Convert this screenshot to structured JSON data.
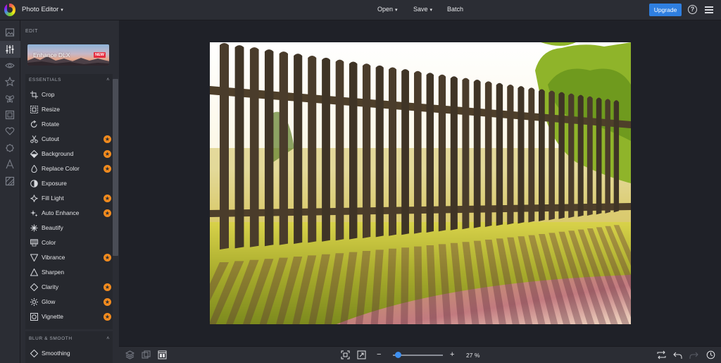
{
  "app": {
    "title": "Photo Editor"
  },
  "topbar": {
    "menus": [
      {
        "label": "Open",
        "has_dropdown": true
      },
      {
        "label": "Save",
        "has_dropdown": true
      },
      {
        "label": "Batch",
        "has_dropdown": false
      }
    ],
    "upgrade_label": "Upgrade",
    "help_glyph": "?",
    "accent_color": "#2f7fe0"
  },
  "rail": {
    "icons": [
      "image-icon",
      "sliders-icon",
      "eye-icon",
      "star-icon",
      "butterfly-icon",
      "frame-icon",
      "heart-icon",
      "badge-icon",
      "text-icon",
      "texture-icon"
    ],
    "active_index": 1
  },
  "panel": {
    "edit_label": "EDIT",
    "enhance_card": {
      "title": "Enhance DLX",
      "badge": "NEW"
    },
    "sections": [
      {
        "title": "ESSENTIALS",
        "expanded": true,
        "tools": [
          {
            "label": "Crop",
            "icon": "crop-icon",
            "premium": false
          },
          {
            "label": "Resize",
            "icon": "resize-icon",
            "premium": false
          },
          {
            "label": "Rotate",
            "icon": "rotate-icon",
            "premium": false
          },
          {
            "label": "Cutout",
            "icon": "scissors-icon",
            "premium": true
          },
          {
            "label": "Background",
            "icon": "background-icon",
            "premium": true
          },
          {
            "label": "Replace Color",
            "icon": "drop-icon",
            "premium": true
          },
          {
            "label": "Exposure",
            "icon": "exposure-icon",
            "premium": false
          },
          {
            "label": "Fill Light",
            "icon": "fill-light-icon",
            "premium": true
          },
          {
            "label": "Auto Enhance",
            "icon": "sparkle-icon",
            "premium": true
          },
          {
            "label": "Beautify",
            "icon": "beautify-icon",
            "premium": false
          },
          {
            "label": "Color",
            "icon": "color-icon",
            "premium": false
          },
          {
            "label": "Vibrance",
            "icon": "vibrance-icon",
            "premium": true
          },
          {
            "label": "Sharpen",
            "icon": "sharpen-icon",
            "premium": false
          },
          {
            "label": "Clarity",
            "icon": "clarity-icon",
            "premium": true
          },
          {
            "label": "Glow",
            "icon": "glow-icon",
            "premium": true
          },
          {
            "label": "Vignette",
            "icon": "vignette-icon",
            "premium": true
          }
        ]
      },
      {
        "title": "BLUR & SMOOTH",
        "expanded": true,
        "tools": [
          {
            "label": "Smoothing",
            "icon": "smoothing-icon",
            "premium": false
          }
        ]
      }
    ],
    "premium_color": "#f28b1e"
  },
  "bottombar": {
    "zoom_value": "27",
    "zoom_unit": "%",
    "zoom_fraction": 0.27,
    "minus": "−",
    "plus": "+"
  }
}
